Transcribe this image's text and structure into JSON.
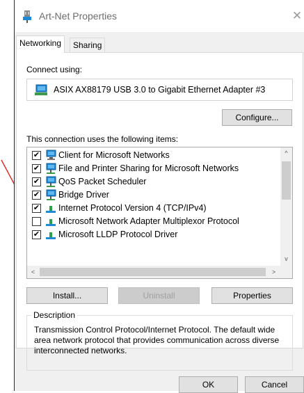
{
  "window": {
    "title": "Art-Net Properties",
    "close_glyph": "✕"
  },
  "tabs": [
    {
      "label": "Networking",
      "active": true
    },
    {
      "label": "Sharing",
      "active": false
    }
  ],
  "connection": {
    "connect_using_label": "Connect using:",
    "adapter_name": "ASIX AX88179 USB 3.0 to Gigabit Ethernet Adapter #3",
    "adapter_icon": "network-adapter-icon",
    "configure_label": "Configure..."
  },
  "items_label": "This connection uses the following items:",
  "items": [
    {
      "label": "Client for Microsoft Networks",
      "checked": true,
      "check_glyph": "✔",
      "icon": "network-client-icon"
    },
    {
      "label": "File and Printer Sharing for Microsoft Networks",
      "checked": true,
      "check_glyph": "✔",
      "icon": "network-service-icon"
    },
    {
      "label": "QoS Packet Scheduler",
      "checked": true,
      "check_glyph": "✔",
      "icon": "network-service-icon"
    },
    {
      "label": "Bridge Driver",
      "checked": true,
      "check_glyph": "✔",
      "icon": "network-service-icon"
    },
    {
      "label": "Internet Protocol Version 4 (TCP/IPv4)",
      "checked": true,
      "check_glyph": "✔",
      "icon": "protocol-icon"
    },
    {
      "label": "Microsoft Network Adapter Multiplexor Protocol",
      "checked": false,
      "check_glyph": "",
      "icon": "protocol-icon"
    },
    {
      "label": "Microsoft LLDP Protocol Driver",
      "checked": true,
      "check_glyph": "✔",
      "icon": "protocol-icon"
    }
  ],
  "scroll": {
    "up": "^",
    "down": "v",
    "left": "<",
    "right": ">"
  },
  "buttons": {
    "install": "Install...",
    "uninstall": "Uninstall",
    "properties": "Properties",
    "ok": "OK",
    "cancel": "Cancel"
  },
  "description": {
    "title": "Description",
    "text": "Transmission Control Protocol/Internet Protocol. The default wide area network protocol that provides communication across diverse interconnected networks."
  },
  "colors": {
    "annotation_arrow": "#e0261b",
    "monitor_blue": "#1e8ad6",
    "protocol_green": "#2aa14b"
  }
}
